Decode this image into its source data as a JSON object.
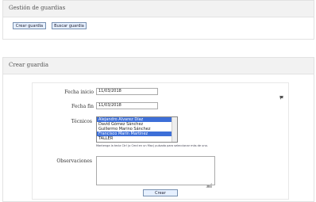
{
  "top_panel": {
    "title": "Gestión de guardias",
    "buttons": [
      "Crear guardia",
      "Buscar guardia"
    ]
  },
  "form_panel": {
    "title": "Crear guardia",
    "fields": {
      "fecha_inicio_label": "Fecha inicio",
      "fecha_inicio_value": "11/03/2018",
      "fecha_fin_label": "Fecha fin",
      "fecha_fin_value": "11/03/2018",
      "tecnicos_label": "Técnicos",
      "tecnicos_options": [
        {
          "label": "Alejandro Álvarez Díaz",
          "selected": true
        },
        {
          "label": "David Gómez Sánchez",
          "selected": false
        },
        {
          "label": "Guillermo Marino Sánchez",
          "selected": false
        },
        {
          "label": "Francisco Marín Martínez",
          "selected": true
        },
        {
          "label": "TALLER",
          "selected": false
        }
      ],
      "tecnicos_note": "Mantenga la tecla Ctrl (o Cmd en un Mac) pulsada para seleccionar más de uno.",
      "observaciones_label": "Observaciones"
    },
    "submit_label": "Crear",
    "icons": [
      "pin-icon",
      "resize-handle-icon"
    ]
  },
  "colors": {
    "button_border": "#7890b0",
    "selection": "#3d6fd8",
    "panel_header": "#f2f2f2"
  }
}
